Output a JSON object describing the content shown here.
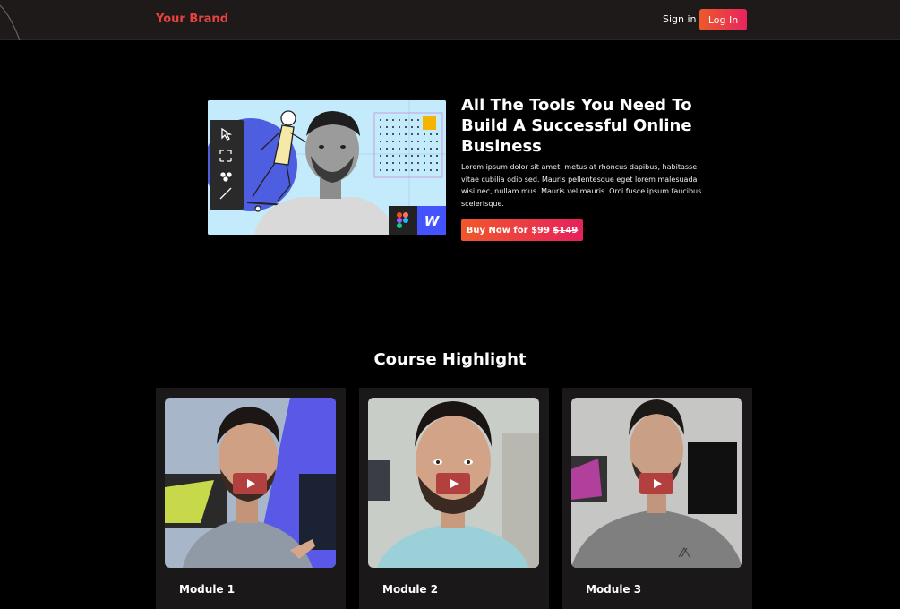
{
  "nav": {
    "brand": "Your Brand",
    "signin": "Sign in",
    "login": "Log In"
  },
  "hero": {
    "title": "All The Tools You Need To Build A Successful Online Business",
    "description": "Lorem ipsum dolor sit amet, metus at rhoncus dapibus, habitasse vitae cubilia odio sed. Mauris pellentesque eget lorem malesuada wisi nec, nullam mus. Mauris vel mauris. Orci fusce ipsum faucibus scelerisque.",
    "button_prefix": "Buy Now for",
    "price_new": "$99",
    "price_old": "$149"
  },
  "highlights": {
    "title": "Course Highlight",
    "modules": [
      {
        "label": "Module 1"
      },
      {
        "label": "Module 2"
      },
      {
        "label": "Module 3"
      }
    ]
  },
  "colors": {
    "accent_start": "#ec5a2a",
    "accent_end": "#e8245d",
    "brand": "#e8423f"
  }
}
